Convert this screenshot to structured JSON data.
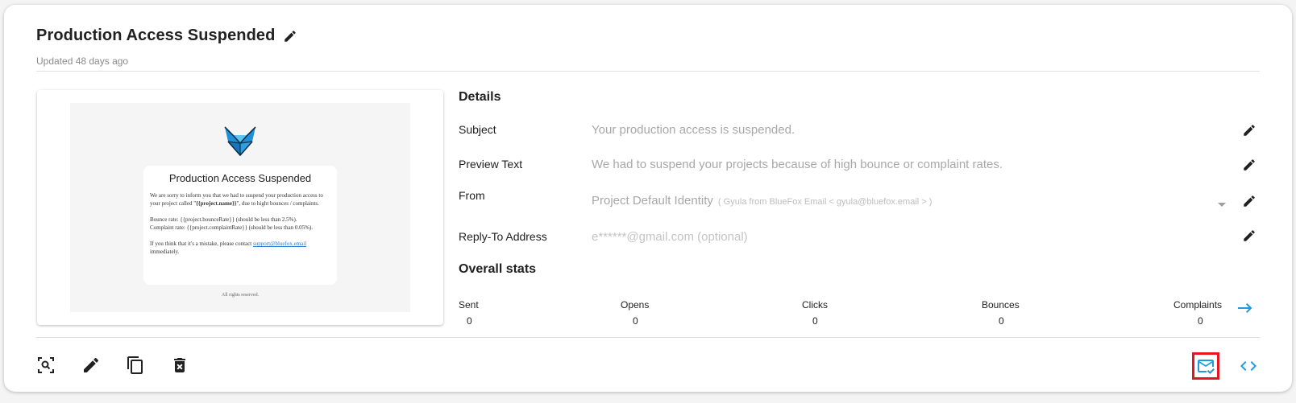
{
  "header": {
    "title": "Production Access Suspended",
    "updated": "Updated 48 days ago"
  },
  "preview": {
    "email_title": "Production Access Suspended",
    "para1_prefix": "We are sorry to inform you that we had to suspend your production access to your project called \"",
    "para1_bold": "{{project.name}}",
    "para1_suffix": "\", due to hight bounces / complaints.",
    "para2_line1": "Bounce rate: {{project.bounceRate}} (should be less than 2.5%).",
    "para2_line2": "Complaint rate: {{project.complaintRate}} (should be less than 0.05%).",
    "para3_prefix": "If you think that it's a mistake, please contact ",
    "para3_link": "support@bluefox.email",
    "para3_suffix": " immediately.",
    "footer": "All rights reserved."
  },
  "details": {
    "heading": "Details",
    "subject_label": "Subject",
    "subject_value": "Your production access is suspended.",
    "preview_label": "Preview Text",
    "preview_value": "We had to suspend your projects because of high bounce or complaint rates.",
    "from_label": "From",
    "from_value": "Project Default Identity",
    "from_sub": "( Gyula from BlueFox Email < gyula@bluefox.email > )",
    "reply_label": "Reply-To Address",
    "reply_placeholder": "e******@gmail.com (optional)"
  },
  "stats": {
    "heading": "Overall stats",
    "items": [
      {
        "label": "Sent",
        "value": "0"
      },
      {
        "label": "Opens",
        "value": "0"
      },
      {
        "label": "Clicks",
        "value": "0"
      },
      {
        "label": "Bounces",
        "value": "0"
      },
      {
        "label": "Complaints",
        "value": "0"
      }
    ]
  },
  "colors": {
    "accent": "#1e9be0",
    "highlight": "#e8141f",
    "icon": "#212121"
  },
  "icons": {
    "title_edit": "pencil-icon",
    "preview": "zoom-preview-icon",
    "edit": "pencil-icon",
    "duplicate": "copy-icon",
    "delete": "trash-icon",
    "test_email": "mail-check-icon",
    "code": "code-icon",
    "stats_arrow": "arrow-right-icon"
  }
}
